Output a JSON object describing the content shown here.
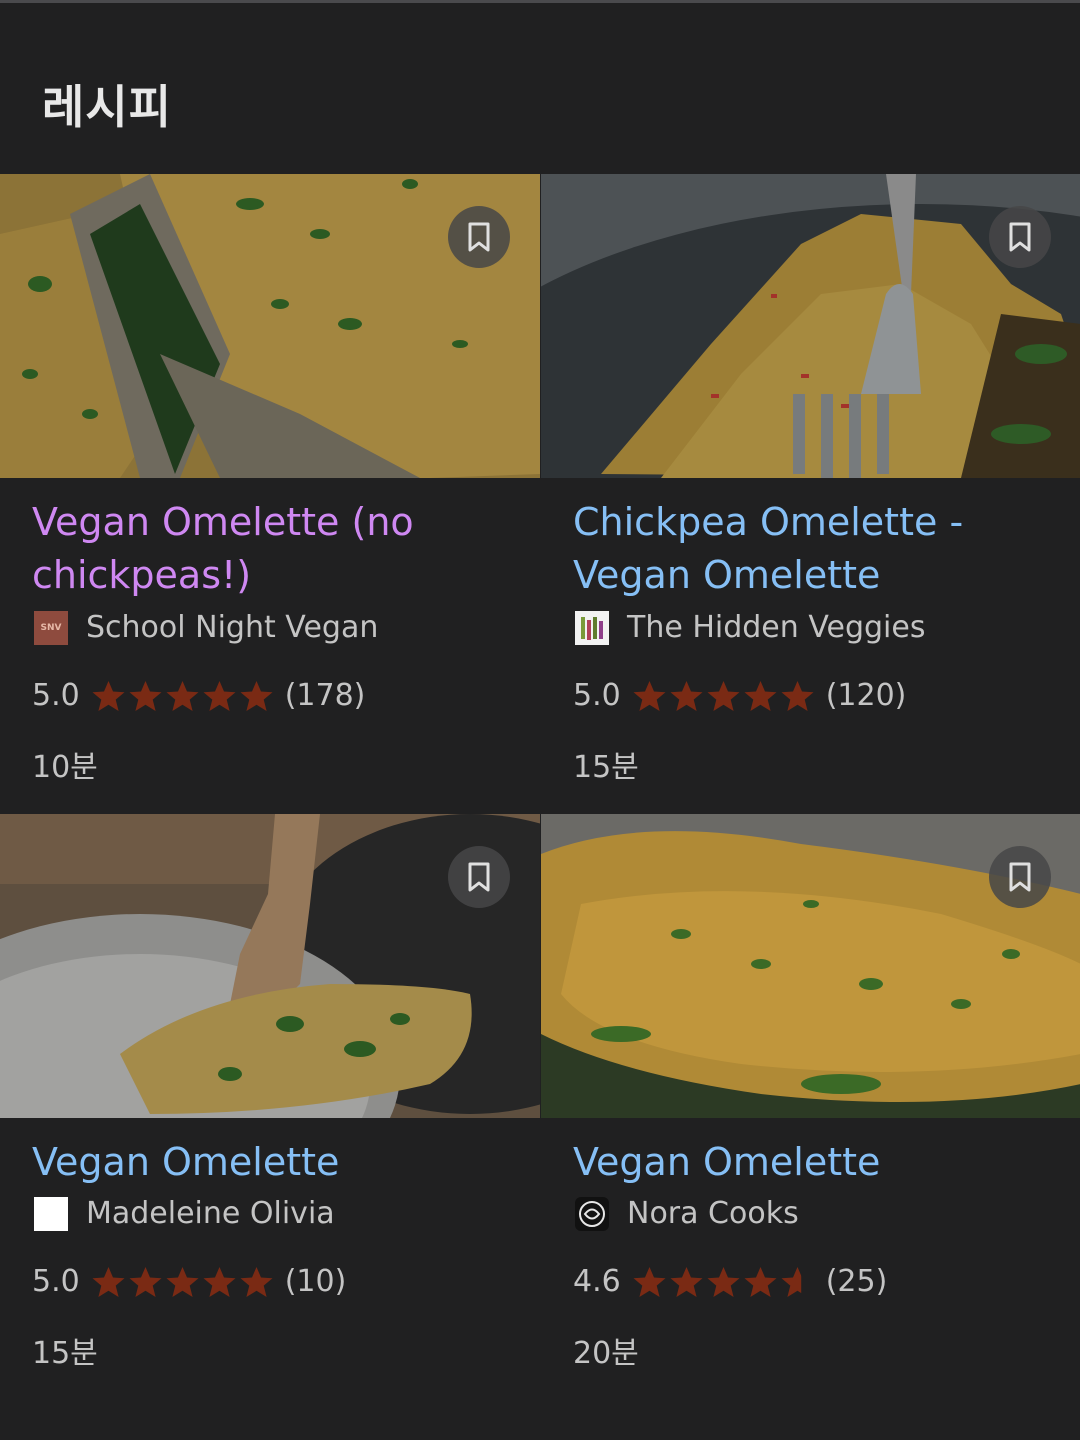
{
  "header": {
    "title": "레시피"
  },
  "colors": {
    "background": "#202021",
    "title_link": "#86bff5",
    "title_visited": "#cf88f2",
    "star": "#7a2a14",
    "secondary_text": "#c4c4c4"
  },
  "recipes": [
    {
      "title": "Vegan Omelette (no chickpeas!)",
      "visited": true,
      "source": "School Night Vegan",
      "source_logo_text": "SNV",
      "rating": "5.0",
      "stars": 5,
      "reviews": "(178)",
      "time": "10분"
    },
    {
      "title": "Chickpea Omelette - Vegan Omelette",
      "visited": false,
      "source": "The Hidden Veggies",
      "rating": "5.0",
      "stars": 5,
      "reviews": "(120)",
      "time": "15분"
    },
    {
      "title": "Vegan Omelette",
      "visited": false,
      "source": "Madeleine Olivia",
      "rating": "5.0",
      "stars": 5,
      "reviews": "(10)",
      "time": "15분"
    },
    {
      "title": "Vegan Omelette",
      "visited": false,
      "source": "Nora Cooks",
      "rating": "4.6",
      "stars": 4.6,
      "reviews": "(25)",
      "time": "20분"
    }
  ]
}
